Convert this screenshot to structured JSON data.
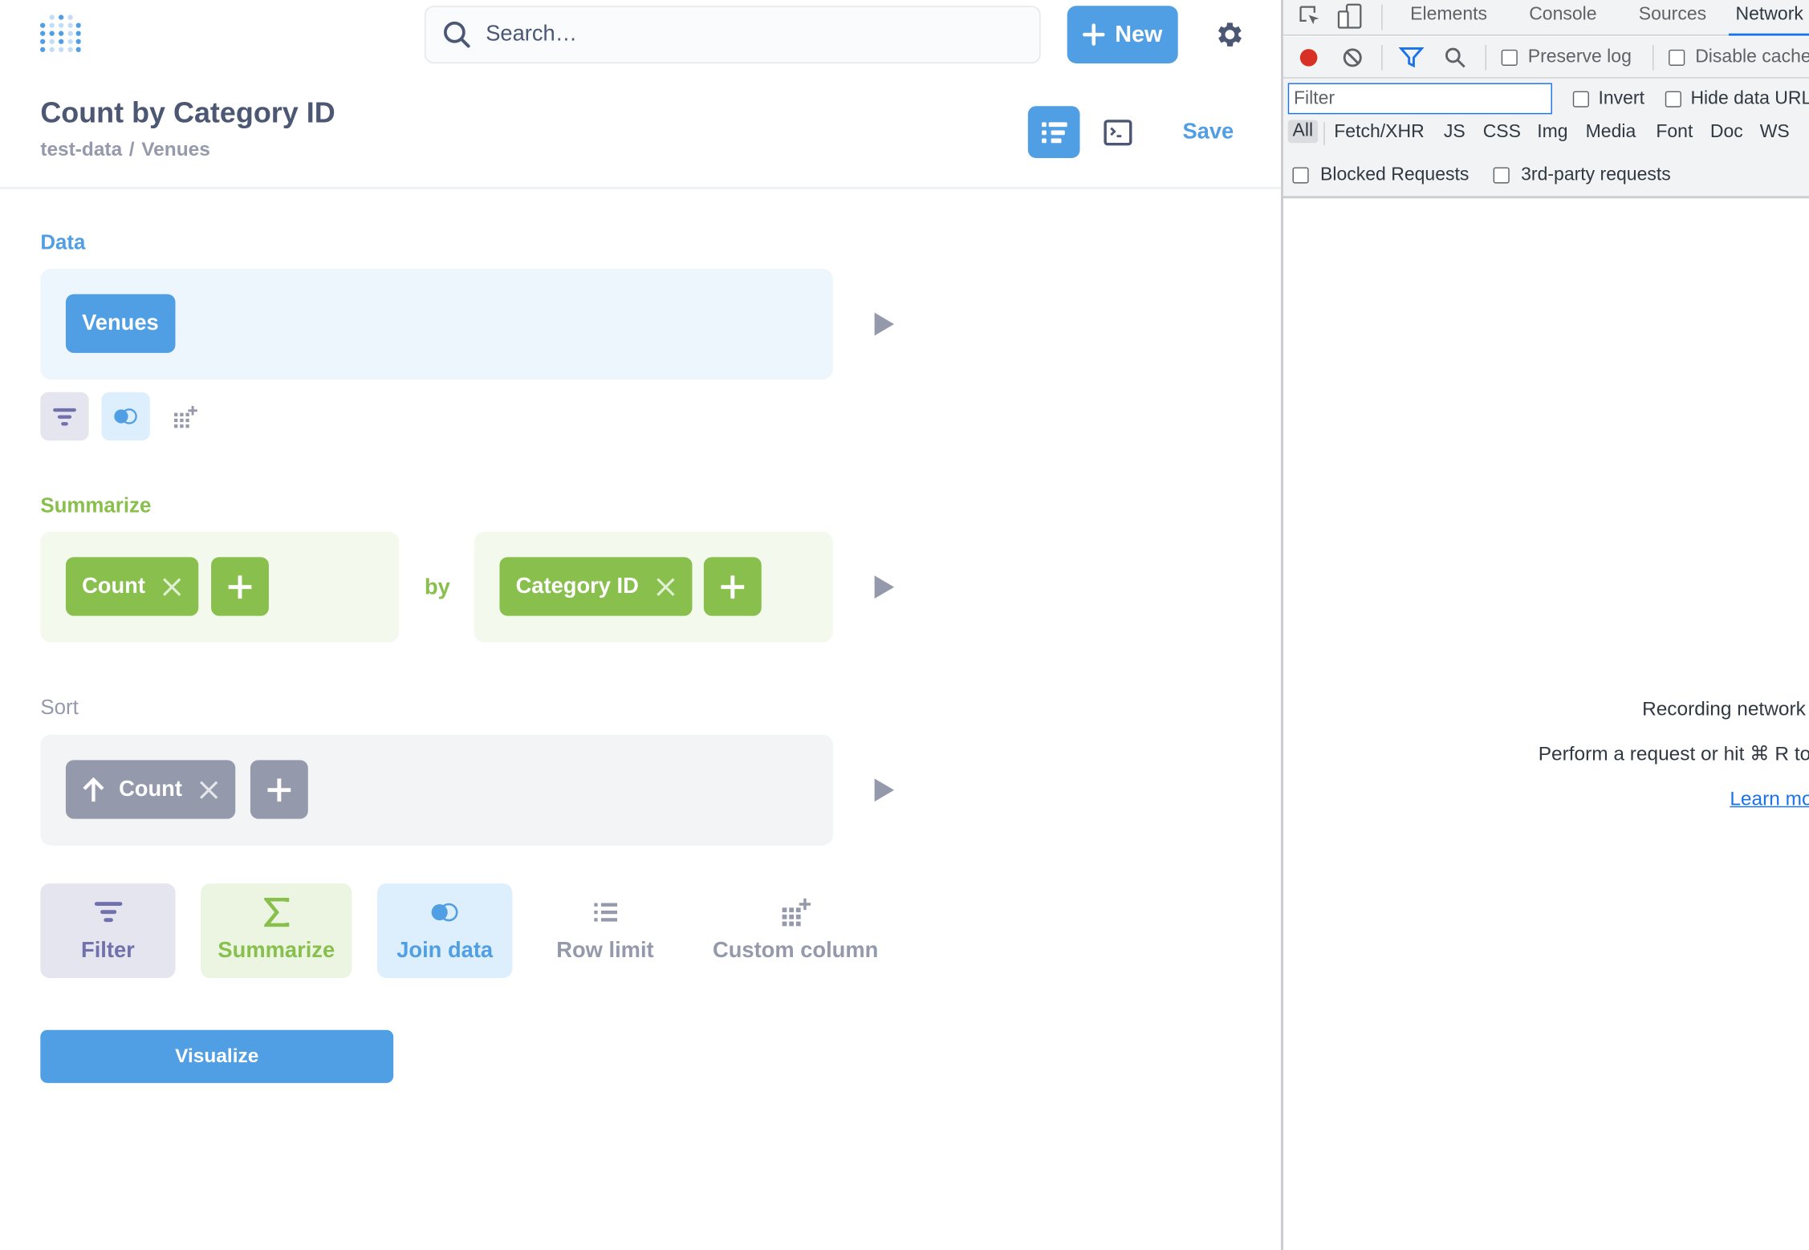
{
  "nav": {
    "search_placeholder": "Search…",
    "new_label": "New"
  },
  "header": {
    "title": "Count by Category ID",
    "breadcrumb": [
      "test-data",
      "Venues"
    ],
    "save_label": "Save"
  },
  "notebook": {
    "data": {
      "label": "Data",
      "table": "Venues"
    },
    "summarize": {
      "label": "Summarize",
      "metric": "Count",
      "by_label": "by",
      "breakout": "Category ID"
    },
    "sort": {
      "label": "Sort",
      "field": "Count",
      "direction": "ascending"
    },
    "actions": [
      {
        "label": "Filter"
      },
      {
        "label": "Summarize"
      },
      {
        "label": "Join data"
      },
      {
        "label": "Row limit"
      },
      {
        "label": "Custom column"
      }
    ],
    "visualize_label": "Visualize"
  },
  "colors": {
    "brand": "#509ee3",
    "summarize": "#88bf4d",
    "filter": "#7172ad",
    "sort": "#949aab",
    "text": "#4c5773"
  },
  "devtools": {
    "tabs": [
      "Elements",
      "Console",
      "Sources",
      "Network"
    ],
    "active_tab": "Network",
    "toolbar": {
      "preserve_log": "Preserve log",
      "disable_cache": "Disable cache"
    },
    "filter_placeholder": "Filter",
    "invert": "Invert",
    "hide_data_urls": "Hide data URLs",
    "types": [
      "All",
      "Fetch/XHR",
      "JS",
      "CSS",
      "Img",
      "Media",
      "Font",
      "Doc",
      "WS"
    ],
    "blocked_requests": "Blocked Requests",
    "third_party": "3rd-party requests",
    "empty_line1": "Recording network activity…",
    "empty_line2": "Perform a request or hit ⌘ R to record the reload.",
    "learn_more": "Learn more"
  }
}
